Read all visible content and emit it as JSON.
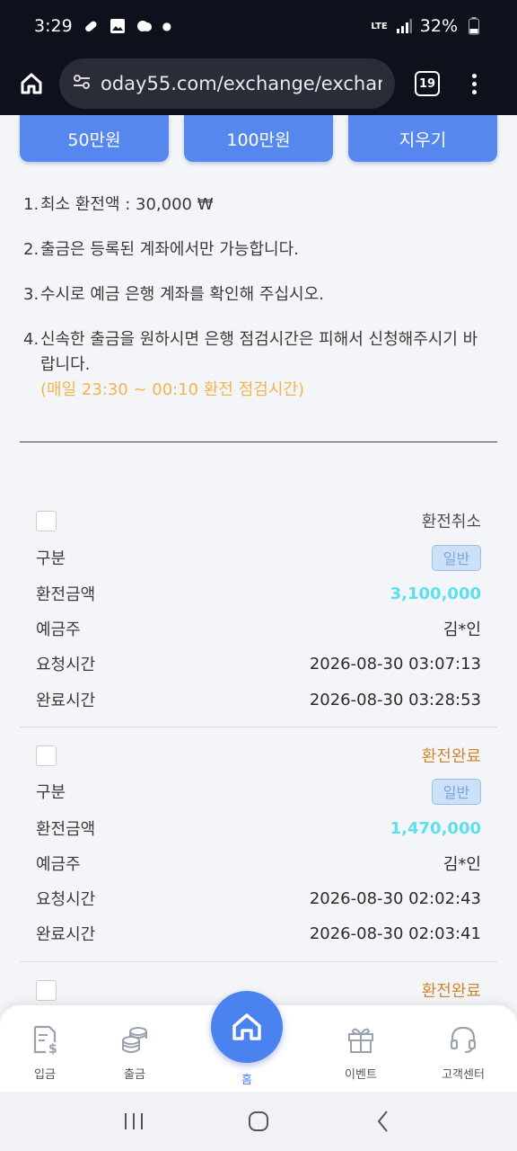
{
  "status_bar": {
    "time": "3:29",
    "network": "LTE",
    "battery": "32%"
  },
  "browser": {
    "url": "oday55.com/exchange/exchang",
    "tab_count": "19"
  },
  "amount_buttons": [
    "50만원",
    "100만원",
    "지우기"
  ],
  "notices": [
    {
      "num": "1.",
      "text": "최소 환전액 : 30,000 ₩"
    },
    {
      "num": "2.",
      "text": "출금은 등록된 계좌에서만 가능합니다."
    },
    {
      "num": "3.",
      "text": "수시로 예금 은행 계좌를 확인해 주십시오."
    },
    {
      "num": "4.",
      "text": "신속한 출금을 원하시면 은행 점검시간은 피해서 신청해주시기 바랍니다.",
      "warning": "(매일 23:30 ~ 00:10 환전 점검시간)"
    }
  ],
  "labels": {
    "type": "구분",
    "amount": "환전금액",
    "depositor": "예금주",
    "requested": "요청시간",
    "completed": "완료시간"
  },
  "records": [
    {
      "status": "환전취소",
      "type": "일반",
      "amount": "3,100,000",
      "depositor": "김*인",
      "requested": "2026-08-30 03:07:13",
      "completed": "2026-08-30 03:28:53"
    },
    {
      "status": "환전완료",
      "type": "일반",
      "amount": "1,470,000",
      "depositor": "김*인",
      "requested": "2026-08-30 02:02:43",
      "completed": "2026-08-30 02:03:41"
    },
    {
      "status": "환전완료"
    }
  ],
  "bottom_nav": [
    {
      "label": "입금",
      "icon": "deposit-icon"
    },
    {
      "label": "출금",
      "icon": "coins-icon"
    },
    {
      "label": "홈",
      "icon": "home-icon"
    },
    {
      "label": "이벤트",
      "icon": "gift-icon"
    },
    {
      "label": "고객센터",
      "icon": "headset-icon"
    }
  ],
  "colors": {
    "accent": "#4a82f0",
    "amount": "#5ee0ea",
    "warning": "#f2b44b",
    "done": "#d0862e"
  }
}
